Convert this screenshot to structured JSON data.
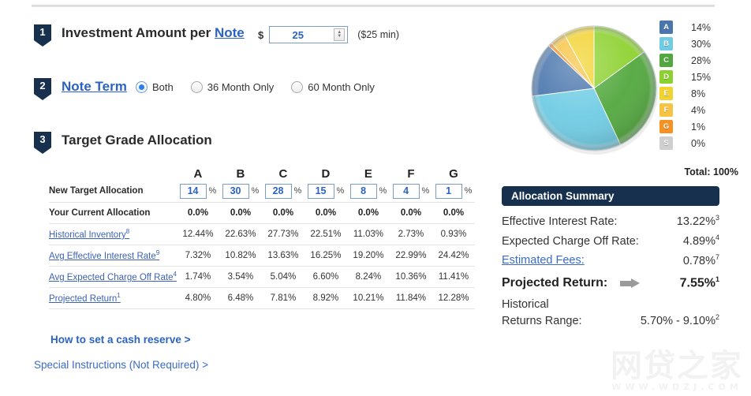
{
  "steps": {
    "one": {
      "number": "1",
      "title_prefix": "Investment Amount per ",
      "title_link": "Note"
    },
    "two": {
      "number": "2",
      "title": "Note Term"
    },
    "three": {
      "number": "3",
      "title": "Target Grade Allocation"
    }
  },
  "amount": {
    "currency_symbol": "$",
    "value": "25",
    "hint": "($25 min)",
    "spinner_up": "▲",
    "spinner_down": "▼"
  },
  "note_term": {
    "options": [
      {
        "label": "Both",
        "selected": true
      },
      {
        "label": "36 Month Only",
        "selected": false
      },
      {
        "label": "60 Month Only",
        "selected": false
      }
    ]
  },
  "allocation_table": {
    "grades": [
      "A",
      "B",
      "C",
      "D",
      "E",
      "F",
      "G"
    ],
    "rows": [
      {
        "label": "New Target Allocation",
        "type": "input",
        "suffix": "%",
        "values": [
          "14",
          "30",
          "28",
          "15",
          "8",
          "4",
          "1"
        ]
      },
      {
        "label": "Your Current Allocation",
        "type": "bold",
        "values": [
          "0.0%",
          "0.0%",
          "0.0%",
          "0.0%",
          "0.0%",
          "0.0%",
          "0.0%"
        ]
      },
      {
        "label": "Historical Inventory",
        "sup": "8",
        "type": "link",
        "values": [
          "12.44%",
          "22.63%",
          "27.73%",
          "22.51%",
          "11.03%",
          "2.73%",
          "0.93%"
        ]
      },
      {
        "label": "Avg Effective Interest Rate",
        "sup": "9",
        "type": "link",
        "values": [
          "7.32%",
          "10.82%",
          "13.63%",
          "16.25%",
          "19.20%",
          "22.99%",
          "24.42%"
        ]
      },
      {
        "label": "Avg Expected Charge Off Rate",
        "sup": "4",
        "type": "link",
        "values": [
          "1.74%",
          "3.54%",
          "5.04%",
          "6.60%",
          "8.24%",
          "10.36%",
          "11.41%"
        ]
      },
      {
        "label": "Projected Return",
        "sup": "1",
        "type": "link",
        "values": [
          "4.80%",
          "6.48%",
          "7.81%",
          "8.92%",
          "10.21%",
          "11.84%",
          "12.28%"
        ]
      }
    ]
  },
  "links": {
    "cash_reserve": "How to set a cash reserve >",
    "special_instructions": "Special Instructions (Not Required) >"
  },
  "chart_data": {
    "type": "pie",
    "title": "",
    "legend_position": "right",
    "total_label": "Total: 100%",
    "categories": [
      "A",
      "B",
      "C",
      "D",
      "E",
      "F",
      "G",
      "S"
    ],
    "values": [
      14,
      30,
      28,
      15,
      8,
      4,
      1,
      0
    ],
    "labels": [
      "14%",
      "30%",
      "28%",
      "15%",
      "8%",
      "4%",
      "1%",
      "0%"
    ],
    "colors": [
      "#4a76ad",
      "#6fcce4",
      "#52a83e",
      "#8dd130",
      "#f2d22e",
      "#f6c343",
      "#f79122",
      "#cfcfcf"
    ],
    "start_angle_deg": -90,
    "direction": "clockwise"
  },
  "summary": {
    "header": "Allocation Summary",
    "rows": [
      {
        "label": "Effective Interest Rate:",
        "value": "13.22%",
        "sup": "3",
        "link": false
      },
      {
        "label": "Expected Charge Off Rate:",
        "value": "4.89%",
        "sup": "4",
        "link": false
      },
      {
        "label": "Estimated Fees:",
        "value": "0.78%",
        "sup": "7",
        "link": true
      }
    ],
    "projected": {
      "label": "Projected Return:",
      "value": "7.55%",
      "sup": "1"
    },
    "historical": {
      "line1": "Historical",
      "line2": "Returns Range:",
      "value": "5.70% - 9.10%",
      "sup": "2"
    }
  },
  "watermark": {
    "main": "网贷之家",
    "sub": "WWW.WDZJ.COM"
  }
}
